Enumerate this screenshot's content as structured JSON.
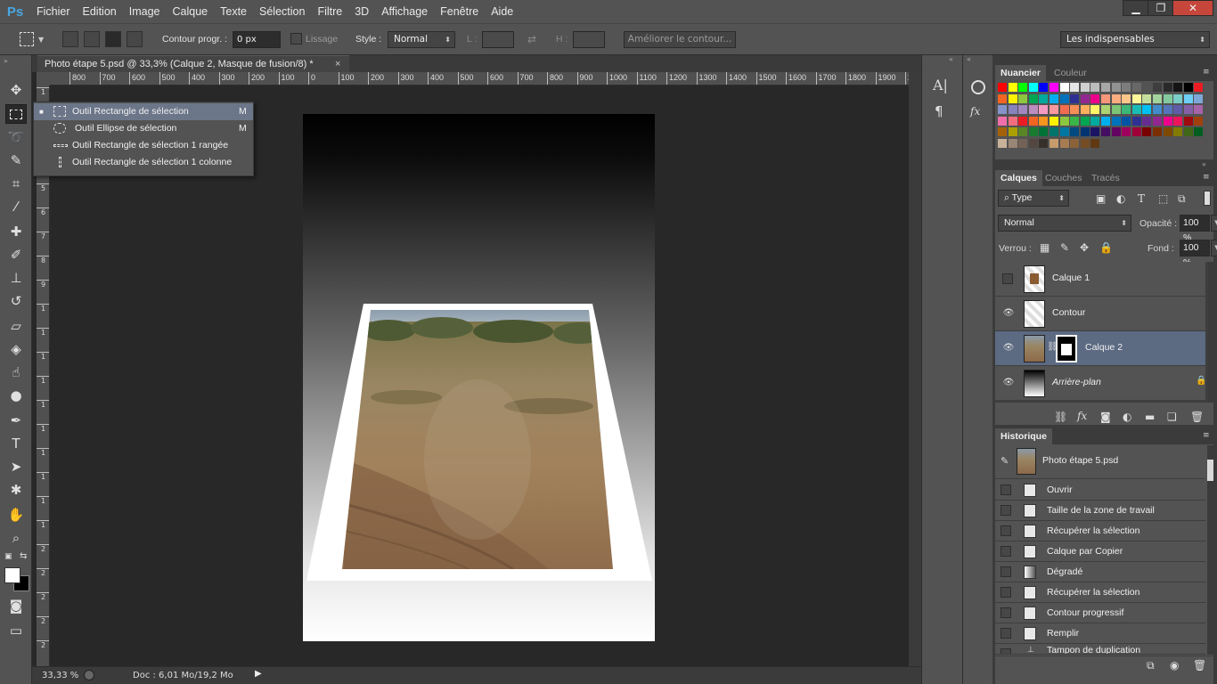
{
  "app": {
    "logo": "Ps"
  },
  "menu": [
    "Fichier",
    "Edition",
    "Image",
    "Calque",
    "Texte",
    "Sélection",
    "Filtre",
    "3D",
    "Affichage",
    "Fenêtre",
    "Aide"
  ],
  "window_controls": {
    "minimize": "▁",
    "restore": "❐",
    "close": "✕"
  },
  "options": {
    "feather_label": "Contour progr. :",
    "feather_value": "0 px",
    "antialias_label": "Lissage",
    "style_label": "Style :",
    "style_value": "Normal",
    "width_label": "L :",
    "height_label": "H :",
    "refine_button": "Améliorer le contour...",
    "workspace": "Les indispensables"
  },
  "document": {
    "tab_title": "Photo étape 5.psd @ 33,3% (Calque 2, Masque de fusion/8) *",
    "close": "×",
    "zoom": "33,33 %",
    "doc_info": "Doc : 6,01 Mo/19,2 Mo"
  },
  "ruler": {
    "h": [
      "800",
      "700",
      "600",
      "500",
      "400",
      "300",
      "200",
      "100",
      "0",
      "100",
      "200",
      "300",
      "400",
      "500",
      "600",
      "700",
      "800",
      "900",
      "1000",
      "1100",
      "1200",
      "1300",
      "1400",
      "1500",
      "1600",
      "1700",
      "1800",
      "1900",
      "20"
    ],
    "v": [
      "1",
      "2",
      "3",
      "4",
      "5",
      "6",
      "7",
      "8",
      "9",
      "1",
      "1",
      "1",
      "1",
      "1",
      "1",
      "1",
      "1",
      "1",
      "1",
      "2",
      "2",
      "2",
      "2",
      "2"
    ]
  },
  "flyout": [
    {
      "label": "Outil Rectangle de sélection",
      "key": "M",
      "selected": true
    },
    {
      "label": "Outil Ellipse de sélection",
      "key": "M",
      "selected": false
    },
    {
      "label": "Outil Rectangle de sélection 1 rangée",
      "key": "",
      "selected": false
    },
    {
      "label": "Outil Rectangle de sélection 1 colonne",
      "key": "",
      "selected": false
    }
  ],
  "swatches_panel": {
    "tabs": [
      "Nuancier",
      "Couleur"
    ],
    "active": "Nuancier"
  },
  "swatch_colors": [
    [
      "#ff0000",
      "#ffff00",
      "#00ff00",
      "#00ffff",
      "#0000ff",
      "#ff00ff",
      "#ffffff",
      "#e6e6e6",
      "#d1d1d1",
      "#bcbcbc",
      "#a7a7a7",
      "#929292",
      "#7d7d7d",
      "#686868",
      "#535353",
      "#3e3e3e",
      "#292929",
      "#141414",
      "#000000",
      "#ed1c24"
    ],
    [
      "#f26522",
      "#fff200",
      "#8dc63f",
      "#00a651",
      "#00a99d",
      "#00aeef",
      "#0072bc",
      "#2e3192",
      "#92278f",
      "#ec008c",
      "#f7977a",
      "#f9ad81",
      "#fdc68a",
      "#fff79a",
      "#c4df9b",
      "#a3d39c",
      "#82ca9d",
      "#7bcdc8",
      "#6dcff6",
      "#7ea7d8"
    ],
    [
      "#8493ca",
      "#8882be",
      "#a187be",
      "#bc8dbf",
      "#f49ac2",
      "#f6989d",
      "#f26c4f",
      "#f68e56",
      "#fbaf5d",
      "#fff467",
      "#acd372",
      "#7cc576",
      "#3bb878",
      "#1abbb4",
      "#00bff3",
      "#438ccb",
      "#5574b9",
      "#605ca8",
      "#855fa8",
      "#a763a8"
    ],
    [
      "#f06eaa",
      "#f26d7d",
      "#ed1c24",
      "#f26522",
      "#f7941d",
      "#fff200",
      "#8dc63f",
      "#39b54a",
      "#00a651",
      "#00a99d",
      "#00aeef",
      "#0072bc",
      "#0054a6",
      "#2e3192",
      "#662d91",
      "#92278f",
      "#ec008c",
      "#ed145b",
      "#9e0b0f",
      "#a0410d"
    ],
    [
      "#a36209",
      "#aba000",
      "#598527",
      "#197b30",
      "#007236",
      "#00746b",
      "#0076a3",
      "#004a80",
      "#003471",
      "#1b1464",
      "#440e62",
      "#630460",
      "#9e005d",
      "#9e0039",
      "#790000",
      "#7b2e00",
      "#7d4900",
      "#827b00",
      "#406618",
      "#005e20"
    ],
    [
      "#c7b299",
      "#998675",
      "#736357",
      "#534741",
      "#37302a",
      "#c69c6d",
      "#a67c52",
      "#8c6239",
      "#754c24",
      "#603913"
    ]
  ],
  "layers_panel": {
    "tabs": [
      "Calques",
      "Couches",
      "Tracés"
    ],
    "active": "Calques",
    "filter": "Type",
    "blend_mode": "Normal",
    "opacity_label": "Opacité :",
    "opacity_value": "100 %",
    "lock_label": "Verrou :",
    "fill_label": "Fond :",
    "fill_value": "100 %",
    "layers": [
      {
        "name": "Calque 1",
        "visible": false,
        "selected": false,
        "italic": false
      },
      {
        "name": "Contour",
        "visible": true,
        "selected": false,
        "italic": false
      },
      {
        "name": "Calque 2",
        "visible": true,
        "selected": true,
        "italic": false
      },
      {
        "name": "Arrière-plan",
        "visible": true,
        "selected": false,
        "italic": true
      }
    ]
  },
  "history_panel": {
    "title": "Historique",
    "snapshot": "Photo étape 5.psd",
    "steps": [
      "Ouvrir",
      "Taille de la zone de travail",
      "Récupérer la sélection",
      "Calque par Copier",
      "Dégradé",
      "Récupérer la sélection",
      "Contour progressif",
      "Remplir",
      "Tampon de duplication"
    ]
  },
  "colors": {
    "panel_bg": "#535353",
    "dark_bg": "#282828",
    "selection": "#5c6a82",
    "flyout_selection": "#6c7689",
    "ps_blue": "#48a6e0"
  }
}
